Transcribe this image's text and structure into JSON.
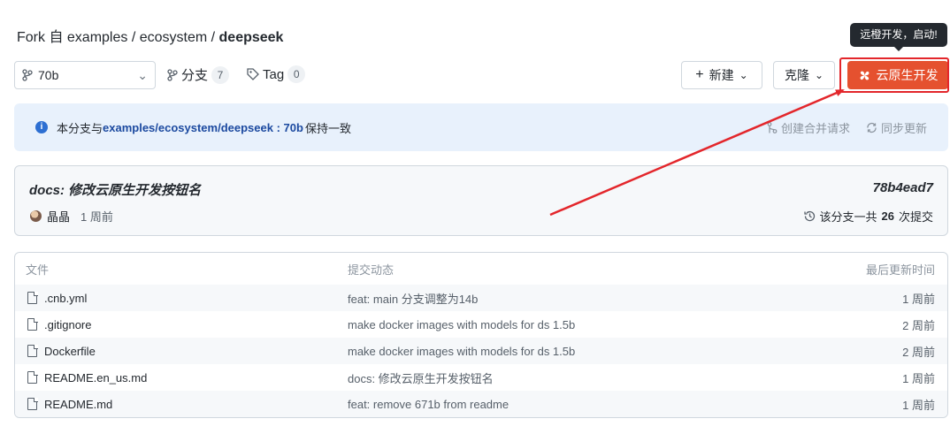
{
  "breadcrumb": {
    "prefix": "Fork 自 examples / ecosystem / ",
    "repo": "deepseek"
  },
  "tooltip": "远橙开发，启动!",
  "toolbar": {
    "branch": "70b",
    "branches_label": "分支",
    "branches_count": "7",
    "tags_label": "Tag",
    "tags_count": "0",
    "new_label": "新建",
    "clone_label": "克隆",
    "cloud_label": "云原生开发"
  },
  "notice": {
    "prefix": "本分支与",
    "repo": "examples/ecosystem/deepseek : 70b",
    "suffix": "保持一致",
    "create_pr": "创建合并请求",
    "sync": "同步更新"
  },
  "commit": {
    "message": "docs: 修改云原生开发按钮名",
    "hash": "78b4ead7",
    "author": "晶晶",
    "ago": "1 周前",
    "count_prefix": "该分支一共",
    "count": "26",
    "count_suffix": "次提交"
  },
  "files": {
    "headers": {
      "file": "文件",
      "commit": "提交动态",
      "updated": "最后更新时间"
    },
    "rows": [
      {
        "name": ".cnb.yml",
        "message": "feat: main 分支调整为14b",
        "time": "1 周前"
      },
      {
        "name": ".gitignore",
        "message": "make docker images with models for ds 1.5b",
        "time": "2 周前"
      },
      {
        "name": "Dockerfile",
        "message": "make docker images with models for ds 1.5b",
        "time": "2 周前"
      },
      {
        "name": "README.en_us.md",
        "message": "docs: 修改云原生开发按钮名",
        "time": "1 周前"
      },
      {
        "name": "README.md",
        "message": "feat: remove 671b from readme",
        "time": "1 周前"
      }
    ]
  },
  "colors": {
    "accent": "#e5512f",
    "annotation": "#e3262b",
    "link": "#1c4aa0",
    "notice_bg": "#e8f1fc"
  }
}
